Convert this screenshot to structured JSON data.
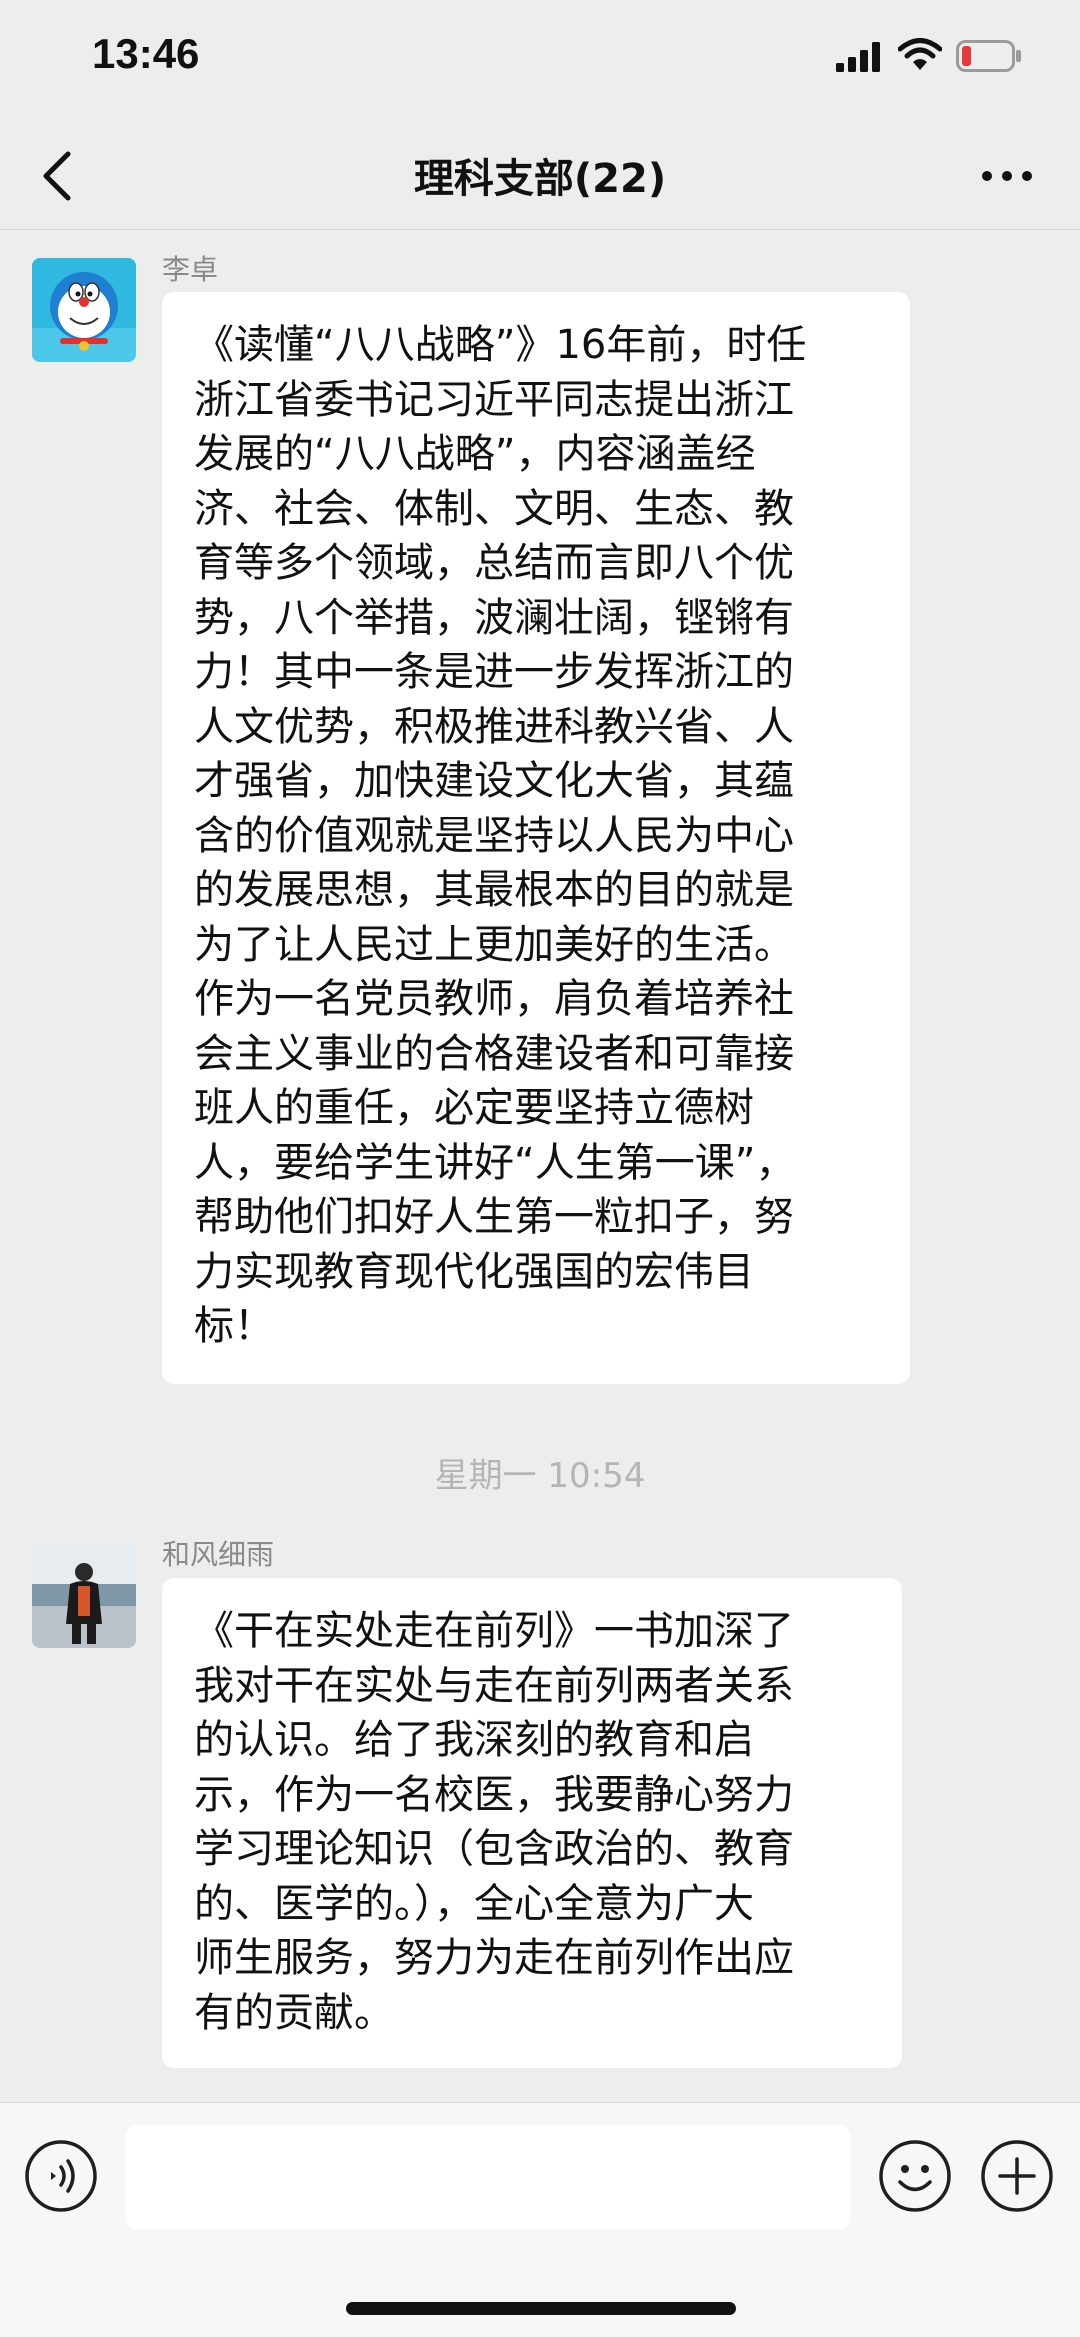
{
  "status_bar": {
    "time": "13:46",
    "icons": [
      "signal-icon",
      "wifi-icon",
      "battery-low-icon"
    ]
  },
  "nav": {
    "title": "理科支部(22)",
    "icons": [
      "chevron-left-icon",
      "more-icon"
    ]
  },
  "messages": [
    {
      "sender": "李卓",
      "avatar_icon": "cartoon-cat-avatar",
      "lines": [
        "《读懂“八八战略”》16年前，时任",
        "浙江省委书记习近平同志提出浙江",
        "发展的“八八战略”，内容涵盖经",
        "济、社会、体制、文明、生态、教",
        "育等多个领域，总结而言即八个优",
        "势，八个举措，波澜壮阔，铿锵有",
        "力！其中一条是进一步发挥浙江的",
        "人文优势，积极推进科教兴省、人",
        "才强省，加快建设文化大省，其蕴",
        "含的价值观就是坚持以人民为中心",
        "的发展思想，其最根本的目的就是",
        "为了让人民过上更加美好的生活。",
        "作为一名党员教师，肩负着培养社",
        "会主义事业的合格建设者和可靠接",
        "班人的重任，必定要坚持立德树",
        "人，要给学生讲好“人生第一课”，",
        "帮助他们扣好人生第一粒扣子，努",
        "力实现教育现代化强国的宏伟目",
        "标！"
      ]
    },
    {
      "sender": "和风细雨",
      "avatar_icon": "person-photo-avatar",
      "lines": [
        "《干在实处走在前列》一书加深了",
        "我对干在实处与走在前列两者关系",
        "的认识。给了我深刻的教育和启",
        "示，作为一名校医，我要静心努力",
        "学习理论知识（包含政治的、教育",
        "的、医学的。），全心全意为广大",
        "师生服务，努力为走在前列作出应",
        "有的贡献。"
      ]
    }
  ],
  "time_divider": "星期一 10:54",
  "input_bar": {
    "placeholder": "",
    "icons": [
      "voice-icon",
      "emoji-icon",
      "plus-icon"
    ]
  },
  "colors": {
    "background": "#ededed",
    "bubble": "#ffffff",
    "text": "#111111",
    "meta_text": "#8a8a8a",
    "battery_low": "#e5393b"
  }
}
